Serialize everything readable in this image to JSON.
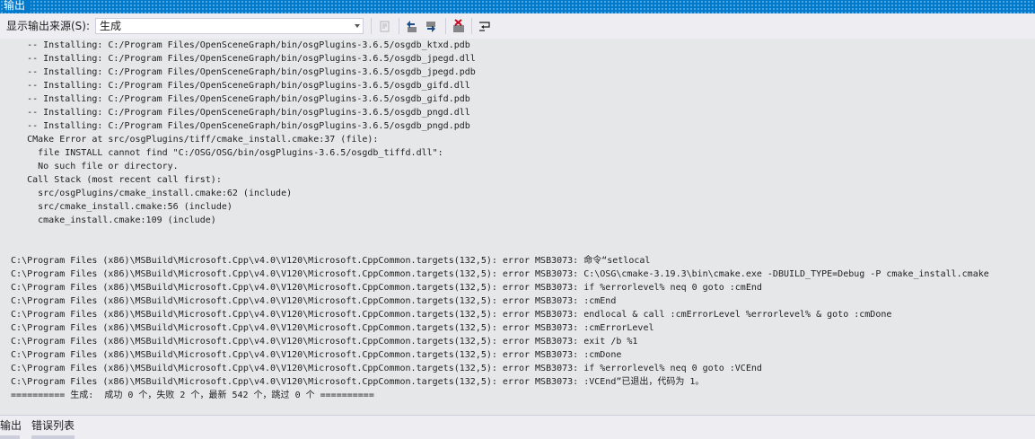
{
  "window": {
    "title": "输出"
  },
  "toolbar": {
    "source_label": "显示输出来源(S):",
    "source_value": "生成",
    "buttons": [
      {
        "icon": "find-message-in-code-icon"
      },
      {
        "icon": "previous-message-icon"
      },
      {
        "icon": "next-message-icon"
      },
      {
        "icon": "clear-all-icon"
      },
      {
        "icon": "toggle-word-wrap-icon"
      }
    ]
  },
  "output": {
    "lines": [
      "     -- Installing: C:/Program Files/OpenSceneGraph/bin/osgPlugins-3.6.5/osgdb_ktxd.pdb",
      "     -- Installing: C:/Program Files/OpenSceneGraph/bin/osgPlugins-3.6.5/osgdb_jpegd.dll",
      "     -- Installing: C:/Program Files/OpenSceneGraph/bin/osgPlugins-3.6.5/osgdb_jpegd.pdb",
      "     -- Installing: C:/Program Files/OpenSceneGraph/bin/osgPlugins-3.6.5/osgdb_gifd.dll",
      "     -- Installing: C:/Program Files/OpenSceneGraph/bin/osgPlugins-3.6.5/osgdb_gifd.pdb",
      "     -- Installing: C:/Program Files/OpenSceneGraph/bin/osgPlugins-3.6.5/osgdb_pngd.dll",
      "     -- Installing: C:/Program Files/OpenSceneGraph/bin/osgPlugins-3.6.5/osgdb_pngd.pdb",
      "     CMake Error at src/osgPlugins/tiff/cmake_install.cmake:37 (file):",
      "       file INSTALL cannot find \"C:/OSG/OSG/bin/osgPlugins-3.6.5/osgdb_tiffd.dll\":",
      "       No such file or directory.",
      "     Call Stack (most recent call first):",
      "       src/osgPlugins/cmake_install.cmake:62 (include)",
      "       src/cmake_install.cmake:56 (include)",
      "       cmake_install.cmake:109 (include)",
      "",
      "",
      "  C:\\Program Files (x86)\\MSBuild\\Microsoft.Cpp\\v4.0\\V120\\Microsoft.CppCommon.targets(132,5): error MSB3073: 命令“setlocal",
      "  C:\\Program Files (x86)\\MSBuild\\Microsoft.Cpp\\v4.0\\V120\\Microsoft.CppCommon.targets(132,5): error MSB3073: C:\\OSG\\cmake-3.19.3\\bin\\cmake.exe -DBUILD_TYPE=Debug -P cmake_install.cmake",
      "  C:\\Program Files (x86)\\MSBuild\\Microsoft.Cpp\\v4.0\\V120\\Microsoft.CppCommon.targets(132,5): error MSB3073: if %errorlevel% neq 0 goto :cmEnd",
      "  C:\\Program Files (x86)\\MSBuild\\Microsoft.Cpp\\v4.0\\V120\\Microsoft.CppCommon.targets(132,5): error MSB3073: :cmEnd",
      "  C:\\Program Files (x86)\\MSBuild\\Microsoft.Cpp\\v4.0\\V120\\Microsoft.CppCommon.targets(132,5): error MSB3073: endlocal & call :cmErrorLevel %errorlevel% & goto :cmDone",
      "  C:\\Program Files (x86)\\MSBuild\\Microsoft.Cpp\\v4.0\\V120\\Microsoft.CppCommon.targets(132,5): error MSB3073: :cmErrorLevel",
      "  C:\\Program Files (x86)\\MSBuild\\Microsoft.Cpp\\v4.0\\V120\\Microsoft.CppCommon.targets(132,5): error MSB3073: exit /b %1",
      "  C:\\Program Files (x86)\\MSBuild\\Microsoft.Cpp\\v4.0\\V120\\Microsoft.CppCommon.targets(132,5): error MSB3073: :cmDone",
      "  C:\\Program Files (x86)\\MSBuild\\Microsoft.Cpp\\v4.0\\V120\\Microsoft.CppCommon.targets(132,5): error MSB3073: if %errorlevel% neq 0 goto :VCEnd",
      "  C:\\Program Files (x86)\\MSBuild\\Microsoft.Cpp\\v4.0\\V120\\Microsoft.CppCommon.targets(132,5): error MSB3073: :VCEnd”已退出，代码为 1。",
      "  ========== 生成:  成功 0 个，失败 2 个，最新 542 个，跳过 0 个 =========="
    ]
  },
  "tabs": [
    {
      "label": "输出",
      "active": true
    },
    {
      "label": "错误列表",
      "active": false
    }
  ]
}
